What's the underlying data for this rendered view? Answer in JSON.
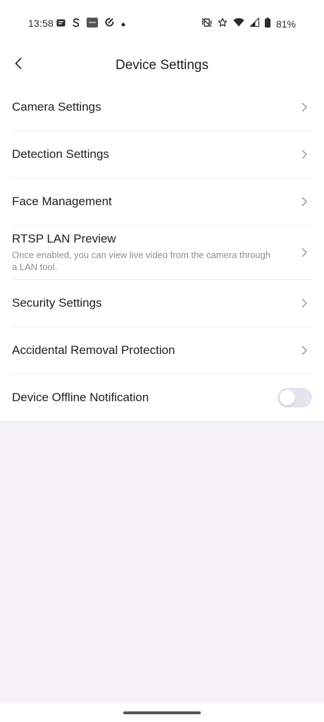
{
  "status_bar": {
    "time": "13:58",
    "battery": "81%",
    "left_icons": [
      "message-icon",
      "s-app-icon",
      "apps-icon",
      "sync-icon",
      "dot-icon"
    ],
    "right_icons": [
      "vibrate-off-icon",
      "star-icon",
      "wifi-icon",
      "signal-icon",
      "battery-icon"
    ]
  },
  "header": {
    "title": "Device Settings"
  },
  "settings": {
    "items": [
      {
        "label": "Camera Settings"
      },
      {
        "label": "Detection Settings"
      },
      {
        "label": "Face Management"
      },
      {
        "label": "RTSP LAN Preview",
        "subtitle": "Once enabled, you can view live video from the camera through a LAN tool."
      },
      {
        "label": "Security Settings"
      },
      {
        "label": "Accidental Removal Protection"
      },
      {
        "label": "Device Offline Notification",
        "toggle_on": false
      }
    ]
  },
  "colors": {
    "background": "#f4f2f8",
    "surface": "#ffffff",
    "text_primary": "#1f1d22",
    "text_secondary": "#8f8c95",
    "toggle_off": "#e6e3ee"
  }
}
